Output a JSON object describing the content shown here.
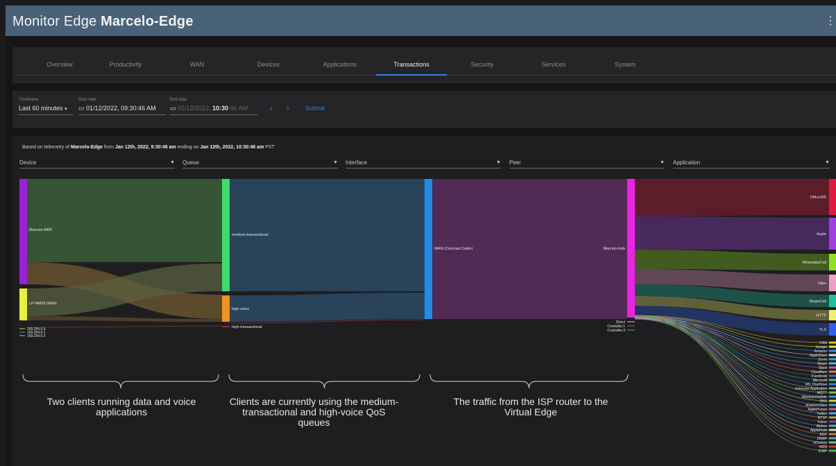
{
  "header": {
    "title_prefix": "Monitor Edge",
    "title_device": "Marcelo-Edge",
    "menu_icon": "kebab-icon"
  },
  "tabs": [
    {
      "label": "Overview"
    },
    {
      "label": "Productivity"
    },
    {
      "label": "WAN"
    },
    {
      "label": "Devices"
    },
    {
      "label": "Applications"
    },
    {
      "label": "Transactions",
      "active": true
    },
    {
      "label": "Security"
    },
    {
      "label": "Services"
    },
    {
      "label": "System"
    }
  ],
  "filters": {
    "timeframe_label": "Timeframe",
    "timeframe_value": "Last 60 minutes",
    "start_label": "Start date",
    "start_value": "01/12/2022, 09:30:46 AM",
    "end_label": "End date",
    "end_value_prefix": "01/12/2022, ",
    "end_value_time": "10:30",
    "end_value_suffix": ":46 AM",
    "prev_arrow": "‹",
    "next_arrow": "›",
    "submit_label": "Submit"
  },
  "telemetry": {
    "prefix": "Based on telemetry of ",
    "device": "Marcelo-Edge",
    "from_text": " from ",
    "start": "Jan 12th, 2022, 9:30:46 am",
    "ending_text": " ending on ",
    "end": "Jan 12th, 2022, 10:30:46 am",
    "tz": " PST"
  },
  "dropdowns": [
    {
      "label": "Device"
    },
    {
      "label": "Queue"
    },
    {
      "label": "Interface"
    },
    {
      "label": "Peer"
    },
    {
      "label": "Application"
    }
  ],
  "sankey": {
    "devices": [
      {
        "label": "Marcelo-MBP",
        "color": "#9b20d9"
      },
      {
        "label": "LP-MMOLINARI",
        "color": "#e8f03a"
      },
      {
        "label": "169.254.0.9",
        "color": "#b8c03a"
      },
      {
        "label": "169.254.0.1",
        "color": "#3a7ed0"
      },
      {
        "label": "169.254.0.3",
        "color": "#d0a030"
      }
    ],
    "queues": [
      {
        "label": "medium-transactional",
        "color": "#3ddc6a"
      },
      {
        "label": "high-voice",
        "color": "#f0921e"
      },
      {
        "label": "high-transactional",
        "color": "#d04040"
      }
    ],
    "interface": {
      "label": "WAN (Comcast Cable)",
      "color": "#1e8ce6"
    },
    "peers": [
      {
        "label": "Marcelo-Hub",
        "color": "#ee22e6"
      },
      {
        "label": "Direct",
        "color": "#d0d0d0"
      },
      {
        "label": "Controller.1",
        "color": "#e04040"
      },
      {
        "label": "Controller.3",
        "color": "#40c060"
      }
    ],
    "apps_big": [
      {
        "label": "Office365",
        "color": "#e01840"
      },
      {
        "label": "Apple",
        "color": "#a040e0"
      },
      {
        "label": "WhatsAppCall",
        "color": "#90e020"
      },
      {
        "label": "https",
        "color": "#f0a0c8"
      },
      {
        "label": "SkypeCall",
        "color": "#20c0a0"
      },
      {
        "label": "HTTP",
        "color": "#f0f070"
      },
      {
        "label": "TLS",
        "color": "#3060f0"
      }
    ],
    "apps_small": [
      {
        "label": "CNN",
        "color": "#e0c020"
      },
      {
        "label": "Google",
        "color": "#e0e040"
      },
      {
        "label": "Amazon",
        "color": "#3090e0"
      },
      {
        "label": "AppleStore",
        "color": "#e0e0e0"
      },
      {
        "label": "Zoom",
        "color": "#40a0e0"
      },
      {
        "label": "Skype",
        "color": "#50c0d0"
      },
      {
        "label": "Slack",
        "color": "#c050c0"
      },
      {
        "label": "Cloudflare",
        "color": "#e08030"
      },
      {
        "label": "Facebook",
        "color": "#4060d0"
      },
      {
        "label": "Microsoft",
        "color": "#40c080"
      },
      {
        "label": "MS_OneDrive",
        "color": "#3080e0"
      },
      {
        "label": "Unknown Application",
        "color": "#a0a0a0"
      },
      {
        "label": "MQTT",
        "color": "#80c040"
      },
      {
        "label": "WindowsUpdate",
        "color": "#4090d0"
      },
      {
        "label": "DNS",
        "color": "#d0d040"
      },
      {
        "label": "AmazonVideo",
        "color": "#30b0e0"
      },
      {
        "label": "AppleiTunes",
        "color": "#e05090"
      },
      {
        "label": "Twitter",
        "color": "#40b0f0"
      },
      {
        "label": "RTSP",
        "color": "#c0a040"
      },
      {
        "label": "Yahoo",
        "color": "#8040c0"
      },
      {
        "label": "Webex",
        "color": "#40c0a0"
      },
      {
        "label": "ApplePush",
        "color": "#d0d0d0"
      },
      {
        "label": "BGP",
        "color": "#c08040"
      },
      {
        "label": "SNMP",
        "color": "#60a0c0"
      },
      {
        "label": "eDonkey",
        "color": "#80c080"
      },
      {
        "label": "MSN",
        "color": "#c04040"
      },
      {
        "label": "ICMP",
        "color": "#40c040"
      }
    ]
  },
  "annotations": [
    {
      "text": "Two clients running data and voice applications"
    },
    {
      "text": "Clients are currently using the medium-transactional and high-voice QoS queues"
    },
    {
      "text": "The traffic from the ISP router to the Virtual Edge"
    }
  ]
}
